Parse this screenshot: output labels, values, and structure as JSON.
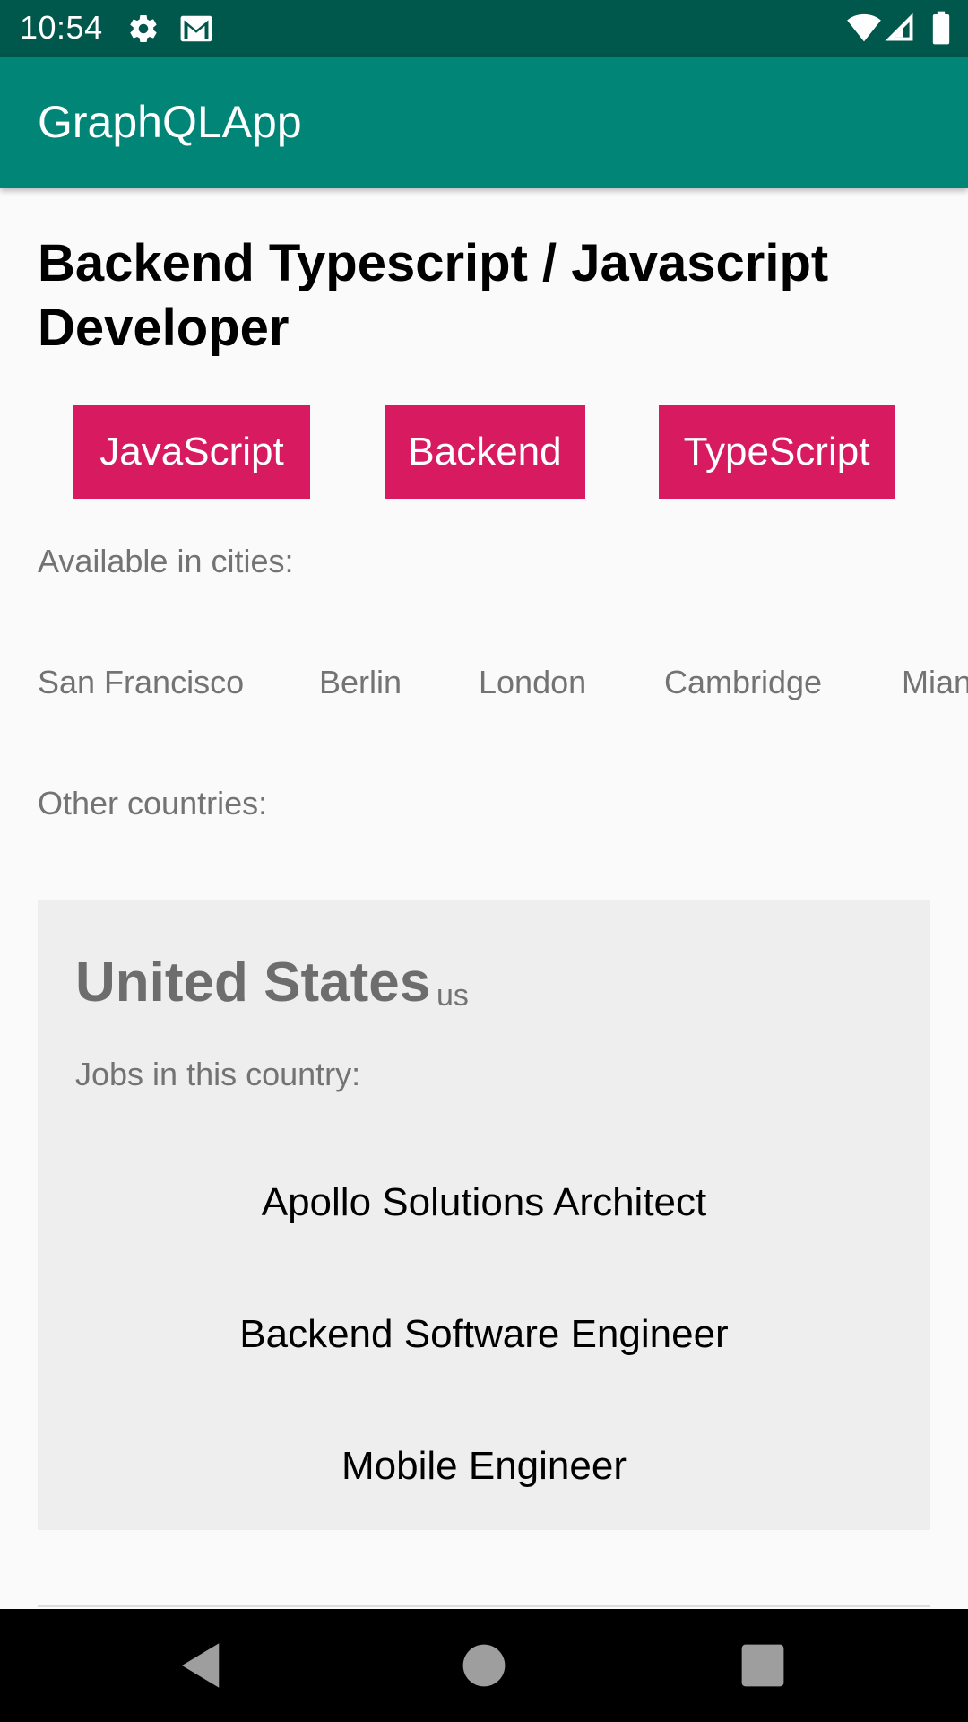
{
  "status_bar": {
    "time": "10:54",
    "icons": [
      "settings-icon",
      "gmail-icon",
      "wifi-icon",
      "signal-icon",
      "battery-icon"
    ]
  },
  "app_bar": {
    "title": "GraphQLApp"
  },
  "job": {
    "title": "Backend Typescript / Javascript Developer",
    "tags": [
      "JavaScript",
      "Backend",
      "TypeScript"
    ]
  },
  "cities": {
    "label": "Available in cities:",
    "items": [
      "San Francisco",
      "Berlin",
      "London",
      "Cambridge",
      "Mian"
    ]
  },
  "countries": {
    "label": "Other countries:",
    "cards": [
      {
        "name": "United States",
        "code": "us",
        "jobs_label": "Jobs in this country:",
        "jobs": [
          "Apollo Solutions Architect",
          "Backend Software Engineer",
          "Mobile Engineer"
        ]
      }
    ]
  },
  "nav_bar": {
    "buttons": [
      "back-icon",
      "home-icon",
      "recents-icon"
    ]
  },
  "colors": {
    "status_bar": "#00574b",
    "app_bar": "#008577",
    "tag_accent": "#d81b60",
    "card_background": "#eeeeee"
  }
}
